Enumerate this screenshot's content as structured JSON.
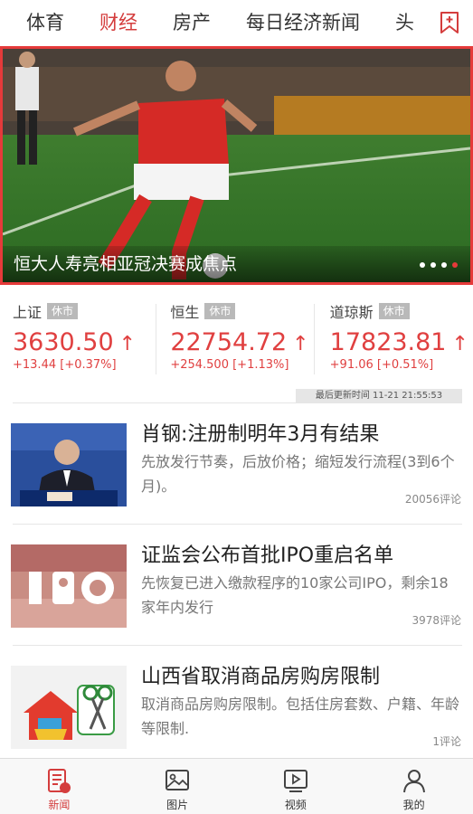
{
  "top_nav": {
    "tabs": [
      {
        "label": "体育"
      },
      {
        "label": "财经",
        "active": true
      },
      {
        "label": "房产"
      },
      {
        "label": "每日经济新闻"
      },
      {
        "label": "头"
      }
    ],
    "bookmark_icon": "bookmark-plus-icon"
  },
  "banner": {
    "caption": "恒大人寿亮相亚冠决赛成焦点",
    "page_count": 4,
    "active_page": 4,
    "accent": "#e53a3a"
  },
  "markets": [
    {
      "name": "上证",
      "badge": "休市",
      "value": "3630.50",
      "arrow": "↑",
      "change": "+13.44 [+0.37%]"
    },
    {
      "name": "恒生",
      "badge": "休市",
      "value": "22754.72",
      "arrow": "↑",
      "change": "+254.500 [+1.13%]"
    },
    {
      "name": "道琼斯",
      "badge": "休市",
      "value": "17823.81",
      "arrow": "↑",
      "change": "+91.06 [+0.51%]"
    }
  ],
  "update_time": "最后更新时间 11-21 21:55:53",
  "news": [
    {
      "title": "肖钢:注册制明年3月有结果",
      "desc": "先放发行节奏，后放价格；缩短发行流程(3到6个月)。",
      "comments": "20056评论",
      "thumb": "press-conference-photo"
    },
    {
      "title": "证监会公布首批IPO重启名单",
      "desc": "先恢复已进入缴款程序的10家公司IPO，剩余18家年内发行",
      "comments": "3978评论",
      "thumb": "ipo-money-photo"
    },
    {
      "title": "山西省取消商品房购房限制",
      "desc": "取消商品房购房限制。包括住房套数、户籍、年龄等限制.",
      "comments": "1评论",
      "thumb": "house-scissors-illustration"
    }
  ],
  "bottom_nav": [
    {
      "label": "新闻",
      "icon": "news-icon",
      "active": true
    },
    {
      "label": "图片",
      "icon": "picture-icon"
    },
    {
      "label": "视频",
      "icon": "video-icon"
    },
    {
      "label": "我的",
      "icon": "user-icon"
    }
  ],
  "colors": {
    "accent": "#d43d3d",
    "up": "#e04040"
  }
}
